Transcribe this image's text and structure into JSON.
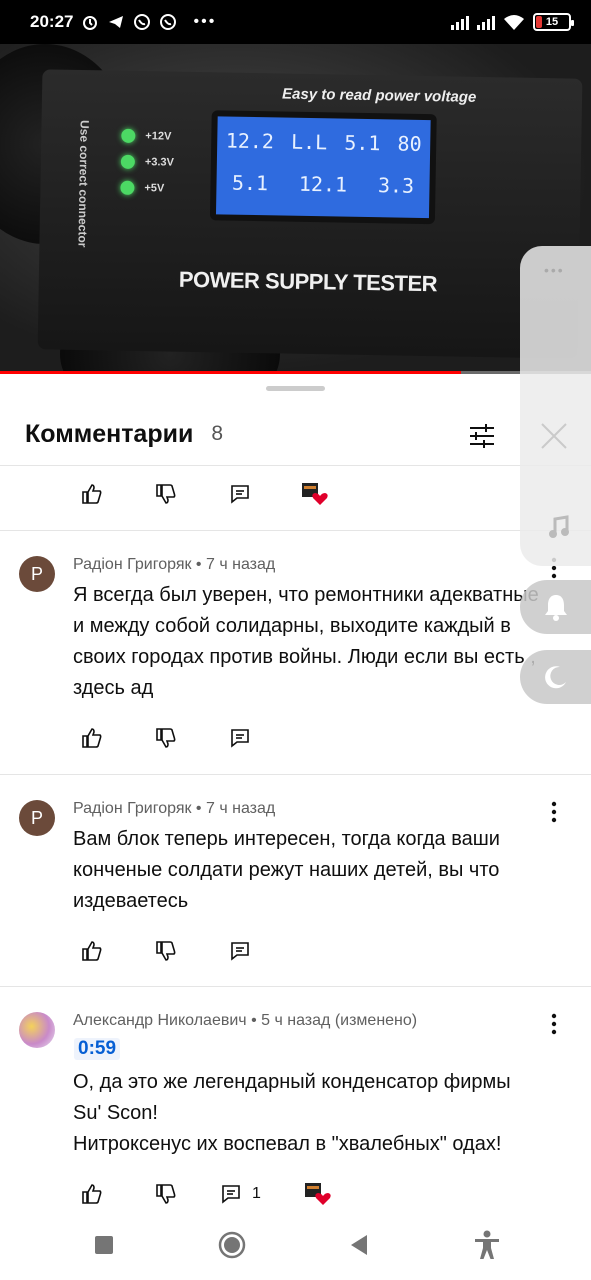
{
  "status_bar": {
    "time": "20:27",
    "battery": "15",
    "icons": [
      "alarm-icon",
      "telegram-icon",
      "viber-icon",
      "viber-icon",
      "more-dots-icon",
      "signal-icon",
      "signal-icon",
      "wifi-icon",
      "battery-icon"
    ]
  },
  "video": {
    "device_title": "Easy to read power voltage",
    "device_label": "POWER SUPPLY TESTER",
    "device_side": "Use correct connector",
    "lcd_top": [
      "12.2",
      "L.L",
      "5.1",
      "80"
    ],
    "lcd_bottom": [
      "5.1",
      "12.1",
      "3.3"
    ],
    "led_labels": [
      "+12V",
      "+3.3V",
      "+5V"
    ],
    "progress": 0.78
  },
  "comments_panel": {
    "title": "Комментарии",
    "count": "8"
  },
  "comments": [
    {
      "author": "Радіон Григоряк",
      "time": "7 ч назад",
      "avatar_letter": "Р",
      "text": "Я всегда был уверен, что ремонтники адекватные и между собой солидарны, выходите каждый в своих городах против войны. Люди если вы есть , здесь ад"
    },
    {
      "author": "Радіон Григоряк",
      "time": "7 ч назад",
      "avatar_letter": "Р",
      "text": "Вам блок теперь интересен, тогда когда ваши конченые солдати режут наших детей, вы что издеваетесь"
    },
    {
      "author": "Александр Николаевич",
      "time": "5 ч назад (изменено)",
      "timestamp_link": "0:59",
      "text_line1": "О, да это же легендарный конденсатор фирмы",
      "text_line2": "Su' Scon!",
      "text_line3": "Нитроксенус их воспевал в \"хвалебных\" одах!",
      "reply_count": "1"
    }
  ],
  "colors": {
    "accent_red": "#ff0000",
    "link_blue": "#065fd4",
    "heart_red": "#e0002b"
  }
}
